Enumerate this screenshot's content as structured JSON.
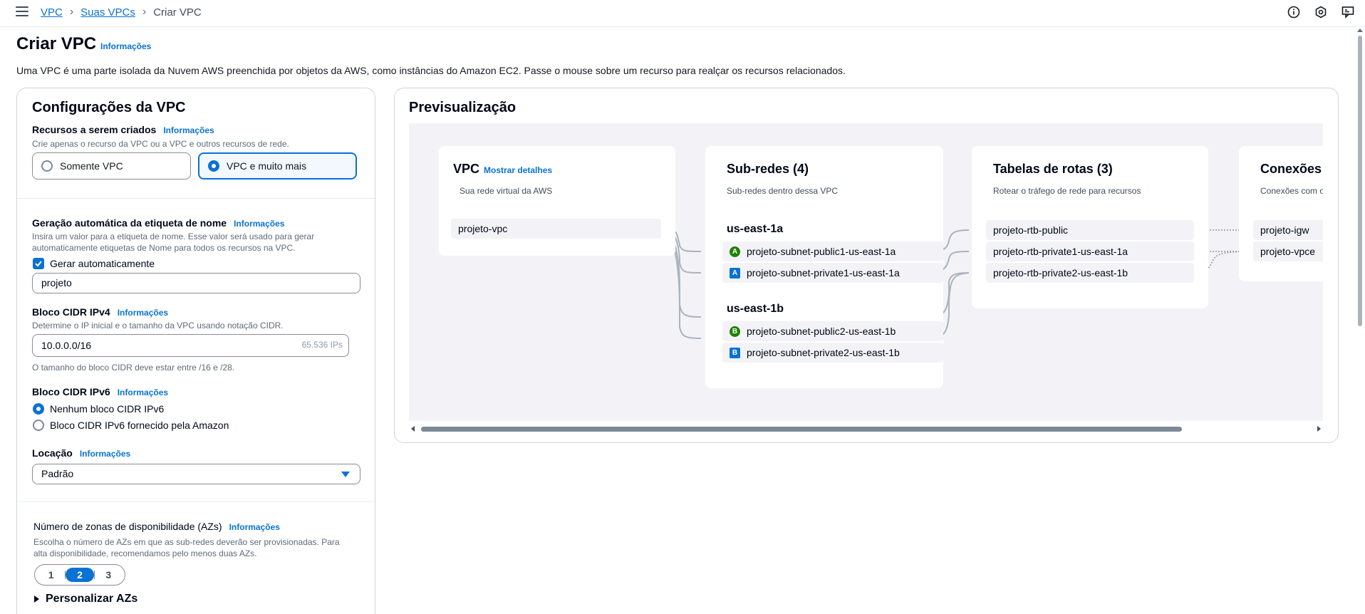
{
  "breadcrumb": {
    "items": [
      "VPC",
      "Suas VPCs"
    ],
    "current": "Criar VPC"
  },
  "page": {
    "title": "Criar VPC",
    "info": "Informações",
    "description": "Uma VPC é uma parte isolada da Nuvem AWS preenchida por objetos da AWS, como instâncias do Amazon EC2. Passe o mouse sobre um recurso para realçar os recursos relacionados."
  },
  "config": {
    "title": "Configurações da VPC",
    "resources": {
      "label": "Recursos a serem criados",
      "info": "Informações",
      "description": "Crie apenas o recurso da VPC ou a VPC e outros recursos de rede.",
      "options": [
        "Somente VPC",
        "VPC e muito mais"
      ],
      "selected": "VPC e muito mais"
    },
    "name_tag": {
      "label": "Geração automática da etiqueta de nome",
      "info": "Informações",
      "description_line1": "Insira um valor para a etiqueta de nome. Esse valor será usado para gerar",
      "description_line2": "automaticamente etiquetas de Nome para todos os recursos na VPC.",
      "checkbox_label": "Gerar automaticamente",
      "checked": true,
      "value": "projeto"
    },
    "ipv4": {
      "label": "Bloco CIDR IPv4",
      "info": "Informações",
      "description": "Determine o IP inicial e o tamanho da VPC usando notação CIDR.",
      "value": "10.0.0.0/16",
      "suffix": "65.536 IPs",
      "constraint": "O tamanho do bloco CIDR deve estar entre /16 e /28."
    },
    "ipv6": {
      "label": "Bloco CIDR IPv6",
      "info": "Informações",
      "options": [
        "Nenhum bloco CIDR IPv6",
        "Bloco CIDR IPv6 fornecido pela Amazon"
      ],
      "selected": "Nenhum bloco CIDR IPv6"
    },
    "tenancy": {
      "label": "Locação",
      "info": "Informações",
      "value": "Padrão"
    },
    "azs": {
      "label": "Número de zonas de disponibilidade (AZs)",
      "info": "Informações",
      "description_line1": "Escolha o número de AZs em que as sub-redes deverão ser provisionadas. Para",
      "description_line2": "alta disponibilidade, recomendamos pelo menos duas AZs.",
      "options": [
        "1",
        "2",
        "3"
      ],
      "selected": "2",
      "customize": "Personalizar AZs"
    }
  },
  "preview": {
    "title": "Previsualização",
    "vpc": {
      "title": "VPC",
      "link": "Mostrar detalhes",
      "subtitle": "Sua rede virtual da AWS",
      "resource": "projeto-vpc"
    },
    "subnets": {
      "title": "Sub-redes (4)",
      "subtitle": "Sub-redes dentro dessa VPC",
      "zones": [
        {
          "name": "us-east-1a",
          "items": [
            {
              "badge": "A",
              "type": "public",
              "name": "projeto-subnet-public1-us-east-1a"
            },
            {
              "badge": "A",
              "type": "private",
              "name": "projeto-subnet-private1-us-east-1a"
            }
          ]
        },
        {
          "name": "us-east-1b",
          "items": [
            {
              "badge": "B",
              "type": "public",
              "name": "projeto-subnet-public2-us-east-1b"
            },
            {
              "badge": "B",
              "type": "private",
              "name": "projeto-subnet-private2-us-east-1b"
            }
          ]
        }
      ]
    },
    "route_tables": {
      "title": "Tabelas de rotas (3)",
      "subtitle": "Rotear o tráfego de rede para recursos",
      "items": [
        "projeto-rtb-public",
        "projeto-rtb-private1-us-east-1a",
        "projeto-rtb-private2-us-east-1b"
      ]
    },
    "connections": {
      "title": "Conexões",
      "subtitle": "Conexões com o",
      "items": [
        "projeto-igw",
        "projeto-vpce"
      ]
    }
  },
  "colors": {
    "accent": "#0972d3",
    "public_badge": "#1d8102",
    "private_badge": "#0972d3",
    "canvas": "#f3f3f7"
  },
  "icons": [
    "menu-icon",
    "info-icon",
    "settings-icon",
    "feedback-icon"
  ]
}
